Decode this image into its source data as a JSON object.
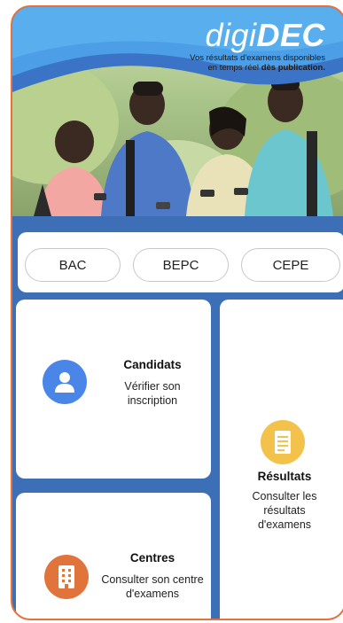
{
  "brand": {
    "logo_light": "digi",
    "logo_bold": "DEC",
    "tagline_line1": "Vos résultats d'examens disponibles",
    "tagline_line2_prefix": "en temps réel ",
    "tagline_line2_bold": "dès publication."
  },
  "exam_tabs": [
    {
      "label": "BAC"
    },
    {
      "label": "BEPC"
    },
    {
      "label": "CEPE"
    }
  ],
  "cards": {
    "candidats": {
      "title": "Candidats",
      "subtitle": "Vérifier son inscription",
      "icon": "person-icon",
      "icon_color": "#4a86e8"
    },
    "resultats": {
      "title": "Résultats",
      "subtitle": "Consulter les résultats d'examens",
      "icon": "document-icon",
      "icon_color": "#f2c24b"
    },
    "centres": {
      "title": "Centres",
      "subtitle": "Consulter son centre d'examens",
      "icon": "building-icon",
      "icon_color": "#e0743a"
    }
  },
  "colors": {
    "accent_blue": "#3d6fb6",
    "border_orange": "#e8703a"
  }
}
